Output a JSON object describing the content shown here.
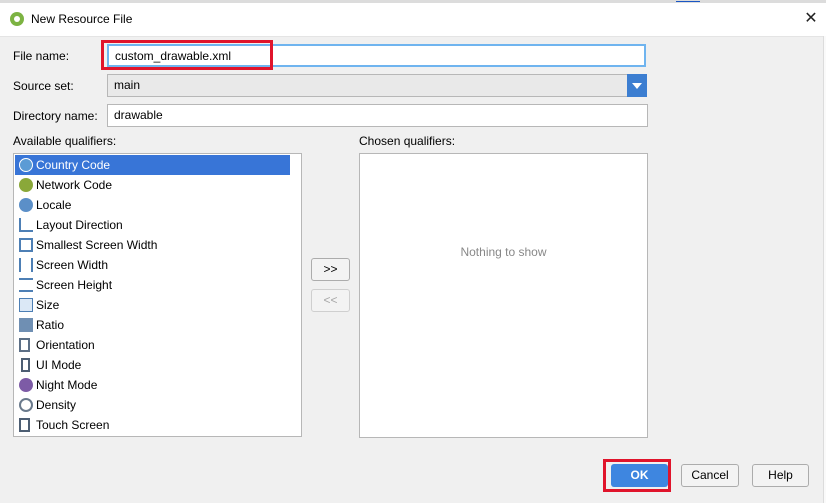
{
  "window": {
    "title": "New Resource File",
    "close_glyph": "✕"
  },
  "form": {
    "file_name_label": "File name:",
    "file_name_value": "custom_drawable.xml",
    "source_set_label": "Source set:",
    "source_set_value": "main",
    "directory_name_label": "Directory name:",
    "directory_name_value": "drawable"
  },
  "available": {
    "label": "Available qualifiers:",
    "items": [
      {
        "label": "Country Code",
        "icon": "globe-icon",
        "selected": true
      },
      {
        "label": "Network Code",
        "icon": "network-icon"
      },
      {
        "label": "Locale",
        "icon": "globe-icon"
      },
      {
        "label": "Layout Direction",
        "icon": "layout-direction-icon"
      },
      {
        "label": "Smallest Screen Width",
        "icon": "screen-width-icon"
      },
      {
        "label": "Screen Width",
        "icon": "screen-width-icon"
      },
      {
        "label": "Screen Height",
        "icon": "screen-height-icon"
      },
      {
        "label": "Size",
        "icon": "size-icon"
      },
      {
        "label": "Ratio",
        "icon": "ratio-icon"
      },
      {
        "label": "Orientation",
        "icon": "orientation-icon"
      },
      {
        "label": "UI Mode",
        "icon": "ui-mode-icon"
      },
      {
        "label": "Night Mode",
        "icon": "night-mode-icon"
      },
      {
        "label": "Density",
        "icon": "density-icon"
      },
      {
        "label": "Touch Screen",
        "icon": "touch-screen-icon"
      }
    ]
  },
  "chosen": {
    "label": "Chosen qualifiers:",
    "empty_text": "Nothing to show"
  },
  "transfer": {
    "add_label": ">>",
    "remove_label": "<<"
  },
  "footer": {
    "ok_label": "OK",
    "cancel_label": "Cancel",
    "help_label": "Help"
  },
  "colors": {
    "accent": "#3c7ed1",
    "selection": "#3875d7",
    "highlight_box": "#e0142b"
  }
}
